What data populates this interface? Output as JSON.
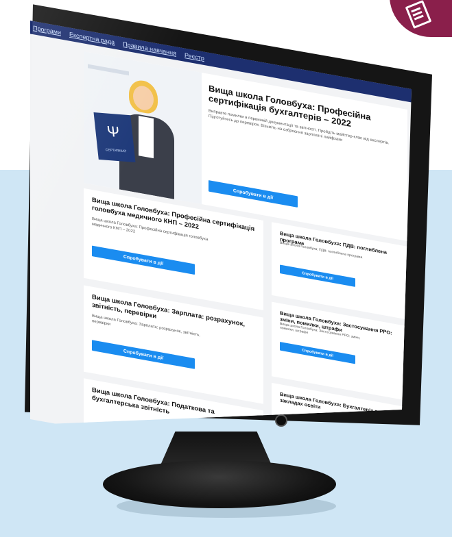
{
  "nav": {
    "items": [
      "Програми",
      "Експертна рада",
      "Правила навчання",
      "Реєстр"
    ]
  },
  "hero": {
    "title": "Вища школа Головбуха: Професійна сертифікація бухгалтерів – 2022",
    "description": "Виправте помилки в первинній документації та звітності. Пройдіть майстер-клас від експертів. Підготуйтесь до перевірок. Візьміть на озброєння зарплатні лайфхаки",
    "button": "Спробувати в дії",
    "certificate_label": "СЕРТИФІКАТ"
  },
  "cards": [
    {
      "title": "Вища школа Головбуха: Професійна сертифікація головбуха медичного КНП – 2022",
      "text": "Вища школа Головбуха: Професійна сертифікація головбуха медичного КНП – 2022",
      "button": "Спробувати в дії"
    },
    {
      "title": "Вища школа Головбуха: ПДВ: поглиблена програма",
      "text": "Вища школа Головбуха: ПДВ: поглиблена програма",
      "button": "Спробувати в дії"
    },
    {
      "title": "Вища школа Головбуха: Зарплата: розрахунок, звітність, перевірки",
      "text": "Вища школа Головбуха: Зарплата: розрахунок, звітність, перевірки",
      "button": "Спробувати в дії"
    },
    {
      "title": "Вища школа Головбуха: Застосування РРО: зміни, помилки, штрафи",
      "text": "Вища школа Головбуха: Застосування РРО: зміни, помилки, штрафи",
      "button": "Спробувати в дії"
    },
    {
      "title": "Вища школа Головбуха: Податкова та бухгалтерська звітність"
    },
    {
      "title": "Вища школа Головбуха: Бухгалтерія в закладах освіти"
    }
  ],
  "colors": {
    "nav_bg": "#1d2f6f",
    "button": "#1a8cf0",
    "background_blue": "#cfe6f5",
    "badge": "#8a1f4b"
  },
  "icons": {
    "badge": "document-icon",
    "trident": "trident-emblem"
  }
}
